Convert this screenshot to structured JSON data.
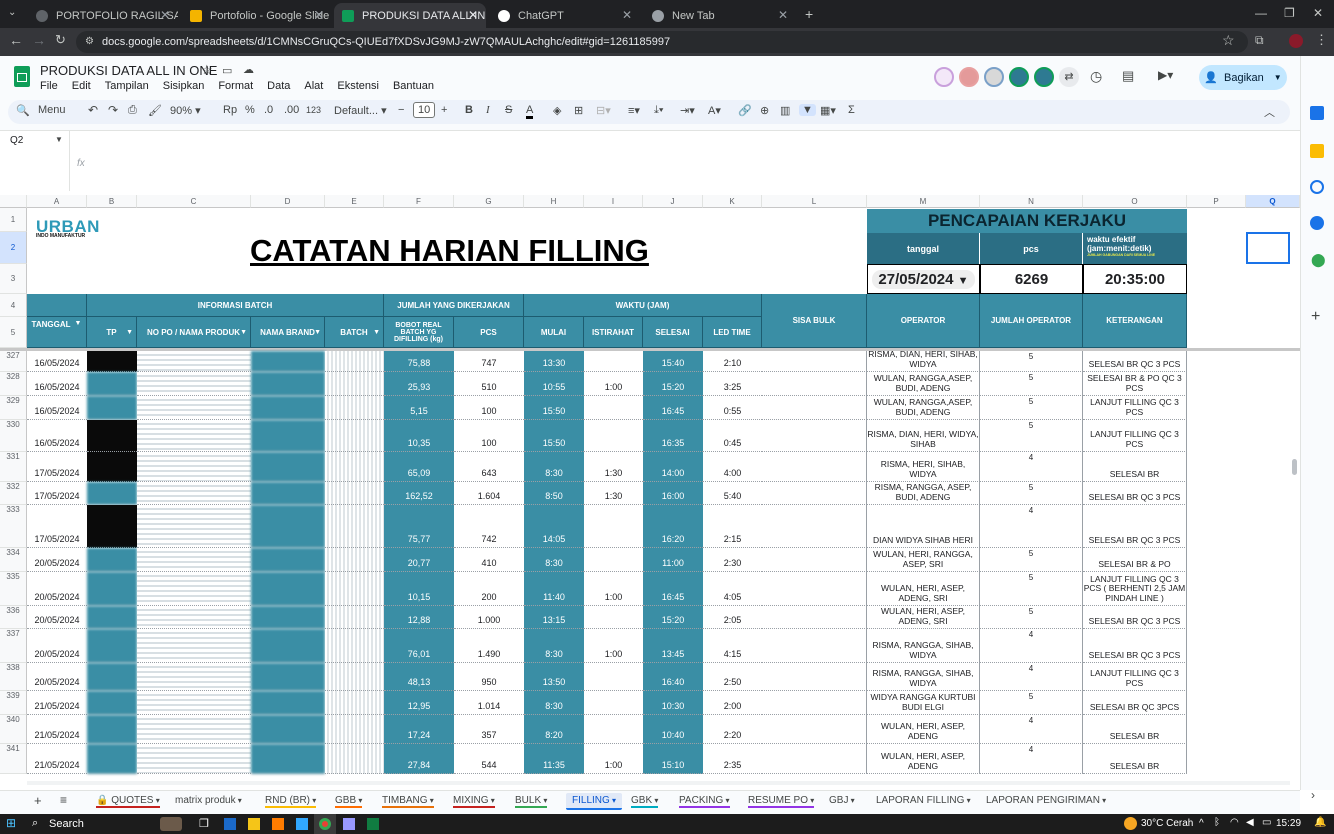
{
  "browser": {
    "tabs": [
      {
        "label": "PORTOFOLIO RAGIL SAPTA - G",
        "color": "#5f6368"
      },
      {
        "label": "Portofolio - Google Slide",
        "color": "#f4b400"
      },
      {
        "label": "PRODUKSI DATA ALL IN ONE -",
        "color": "#0f9d58"
      },
      {
        "label": "ChatGPT",
        "color": "#fff"
      },
      {
        "label": "New Tab",
        "color": "#9aa0a6"
      }
    ],
    "url": "docs.google.com/spreadsheets/d/1CMNsCGruQCs-QIUEd7fXDSvJG9MJ-zW7QMAULAchghc/edit#gid=1261185997"
  },
  "doc": {
    "title": "PRODUKSI DATA ALL IN ONE",
    "menu": [
      "File",
      "Edit",
      "Tampilan",
      "Sisipkan",
      "Format",
      "Data",
      "Alat",
      "Ekstensi",
      "Bantuan"
    ],
    "share_label": "Bagikan"
  },
  "toolbar": {
    "search": "Menu",
    "zoom": "90%",
    "currency": "Rp",
    "percent": "%",
    "dec_dec": ".0",
    "dec_inc": ".00",
    "numfmt": "123",
    "font": "Default...",
    "font_size": "10"
  },
  "namebox": "Q2",
  "fx": "fx",
  "columns": [
    "A",
    "B",
    "C",
    "D",
    "E",
    "F",
    "G",
    "H",
    "I",
    "J",
    "K",
    "L",
    "M",
    "N",
    "O",
    "P",
    "Q"
  ],
  "sheet": {
    "logo_main": "URBAN",
    "logo_sub": "INDO MANUFAKTUR",
    "title": "CATATAN HARIAN FILLING",
    "pencapaian": "PENCAPAIAN KERJAKU",
    "p_tanggal": "tanggal",
    "p_pcs": "pcs",
    "p_waktu": "waktu efektif (jam:menit:detik)",
    "p_waktu_note": "JUMLAH GABUNGAN DARI SEMUA LINE",
    "p_date_val": "27/05/2024",
    "p_pcs_val": "6269",
    "p_time_val": "20:35:00",
    "h_info": "INFORMASI BATCH",
    "h_jumlah": "JUMLAH YANG DIKERJAKAN",
    "h_waktu": "WAKTU (JAM)",
    "h_tanggal": "TANGGAL",
    "h_tp": "TP",
    "h_po": "NO PO / NAMA PRODUK",
    "h_brand": "NAMA BRAND",
    "h_batch": "BATCH",
    "h_bobot": "BOBOT REAL BATCH YG DIFILLING (kg)",
    "h_pcs": "PCS",
    "h_mulai": "MULAI",
    "h_istirahat": "ISTIRAHAT",
    "h_selesai": "SELESAI",
    "h_led": "LED TIME",
    "h_sisa": "SISA BULK",
    "h_operator": "OPERATOR",
    "h_jml_op": "JUMLAH OPERATOR",
    "h_ket": "KETERANGAN"
  },
  "rows": [
    {
      "n": "327",
      "tgl": "16/05/2024",
      "bobot": "75,88",
      "pcs": "747",
      "mulai": "13:30",
      "ist": "",
      "selesai": "15:40",
      "led": "2:10",
      "op": "RISMA, DIAN, HERI, SIHAB, WIDYA",
      "jml": "5",
      "ket": "SELESAI BR QC 3 PCS"
    },
    {
      "n": "328",
      "tgl": "16/05/2024",
      "bobot": "25,93",
      "pcs": "510",
      "mulai": "10:55",
      "ist": "1:00",
      "selesai": "15:20",
      "led": "3:25",
      "op": "WULAN, RANGGA,ASEP, BUDI, ADENG",
      "jml": "5",
      "ket": "SELESAI BR & PO QC 3 PCS"
    },
    {
      "n": "329",
      "tgl": "16/05/2024",
      "bobot": "5,15",
      "pcs": "100",
      "mulai": "15:50",
      "ist": "",
      "selesai": "16:45",
      "led": "0:55",
      "op": "WULAN, RANGGA,ASEP, BUDI, ADENG",
      "jml": "5",
      "ket": "LANJUT FILLING QC 3 PCS"
    },
    {
      "n": "330",
      "tgl": "16/05/2024",
      "bobot": "10,35",
      "pcs": "100",
      "mulai": "15:50",
      "ist": "",
      "selesai": "16:35",
      "led": "0:45",
      "op": "RISMA, DIAN, HERI, WIDYA, SIHAB",
      "jml": "5",
      "ket": "LANJUT FILLING QC 3 PCS"
    },
    {
      "n": "331",
      "tgl": "17/05/2024",
      "bobot": "65,09",
      "pcs": "643",
      "mulai": "8:30",
      "ist": "1:30",
      "selesai": "14:00",
      "led": "4:00",
      "op": "RISMA, HERI, SIHAB, WIDYA",
      "jml": "4",
      "ket": "SELESAI BR"
    },
    {
      "n": "332",
      "tgl": "17/05/2024",
      "bobot": "162,52",
      "pcs": "1.604",
      "mulai": "8:50",
      "ist": "1:30",
      "selesai": "16:00",
      "led": "5:40",
      "op": "RISMA, RANGGA, ASEP, BUDI, ADENG",
      "jml": "5",
      "ket": "SELESAI BR QC 3 PCS"
    },
    {
      "n": "333",
      "tgl": "17/05/2024",
      "bobot": "75,77",
      "pcs": "742",
      "mulai": "14:05",
      "ist": "",
      "selesai": "16:20",
      "led": "2:15",
      "op": "DIAN WIDYA SIHAB HERI",
      "jml": "4",
      "ket": "SELESAI BR QC 3 PCS"
    },
    {
      "n": "334",
      "tgl": "20/05/2024",
      "bobot": "20,77",
      "pcs": "410",
      "mulai": "8:30",
      "ist": "",
      "selesai": "11:00",
      "led": "2:30",
      "op": "WULAN, HERI, RANGGA, ASEP, SRI",
      "jml": "5",
      "ket": "SELESAI BR & PO"
    },
    {
      "n": "335",
      "tgl": "20/05/2024",
      "bobot": "10,15",
      "pcs": "200",
      "mulai": "11:40",
      "ist": "1:00",
      "selesai": "16:45",
      "led": "4:05",
      "op": "WULAN, HERI, ASEP, ADENG, SRI",
      "jml": "5",
      "ket": "LANJUT FILLING QC 3 PCS ( BERHENTI 2,5 JAM PINDAH LINE )"
    },
    {
      "n": "336",
      "tgl": "20/05/2024",
      "bobot": "12,88",
      "pcs": "1.000",
      "mulai": "13:15",
      "ist": "",
      "selesai": "15:20",
      "led": "2:05",
      "op": "WULAN, HERI, ASEP, ADENG, SRI",
      "jml": "5",
      "ket": "SELESAI BR QC 3 PCS"
    },
    {
      "n": "337",
      "tgl": "20/05/2024",
      "bobot": "76,01",
      "pcs": "1.490",
      "mulai": "8:30",
      "ist": "1:00",
      "selesai": "13:45",
      "led": "4:15",
      "op": "RISMA, RANGGA, SIHAB, WIDYA",
      "jml": "4",
      "ket": "SELESAI BR QC 3 PCS"
    },
    {
      "n": "338",
      "tgl": "20/05/2024",
      "bobot": "48,13",
      "pcs": "950",
      "mulai": "13:50",
      "ist": "",
      "selesai": "16:40",
      "led": "2:50",
      "op": "RISMA, RANGGA, SIHAB, WIDYA",
      "jml": "4",
      "ket": "LANJUT FILLING QC 3 PCS"
    },
    {
      "n": "339",
      "tgl": "21/05/2024",
      "bobot": "12,95",
      "pcs": "1.014",
      "mulai": "8:30",
      "ist": "",
      "selesai": "10:30",
      "led": "2:00",
      "op": "WIDYA RANGGA KURTUBI BUDI ELGI",
      "jml": "5",
      "ket": "SELESAI  BR QC 3PCS"
    },
    {
      "n": "340",
      "tgl": "21/05/2024",
      "bobot": "17,24",
      "pcs": "357",
      "mulai": "8:20",
      "ist": "",
      "selesai": "10:40",
      "led": "2:20",
      "op": "WULAN, HERI, ASEP, ADENG",
      "jml": "4",
      "ket": "SELESAI BR"
    },
    {
      "n": "341",
      "tgl": "21/05/2024",
      "bobot": "27,84",
      "pcs": "544",
      "mulai": "11:35",
      "ist": "1:00",
      "selesai": "15:10",
      "led": "2:35",
      "op": "WULAN, HERI, ASEP, ADENG",
      "jml": "4",
      "ket": "SELESAI BR"
    }
  ],
  "sheet_tabs": [
    "QUOTES",
    "matrix produk",
    "RND (BR)",
    "GBB",
    "TIMBANG",
    "MIXING",
    "BULK",
    "FILLING",
    "GBK",
    "PACKING",
    "RESUME PO",
    "GBJ",
    "LAPORAN FILLING",
    "LAPORAN PENGIRIMAN"
  ],
  "active_tab": "FILLING",
  "taskbar": {
    "search": "Search",
    "weather": "30°C Cerah",
    "time": "15:29"
  }
}
